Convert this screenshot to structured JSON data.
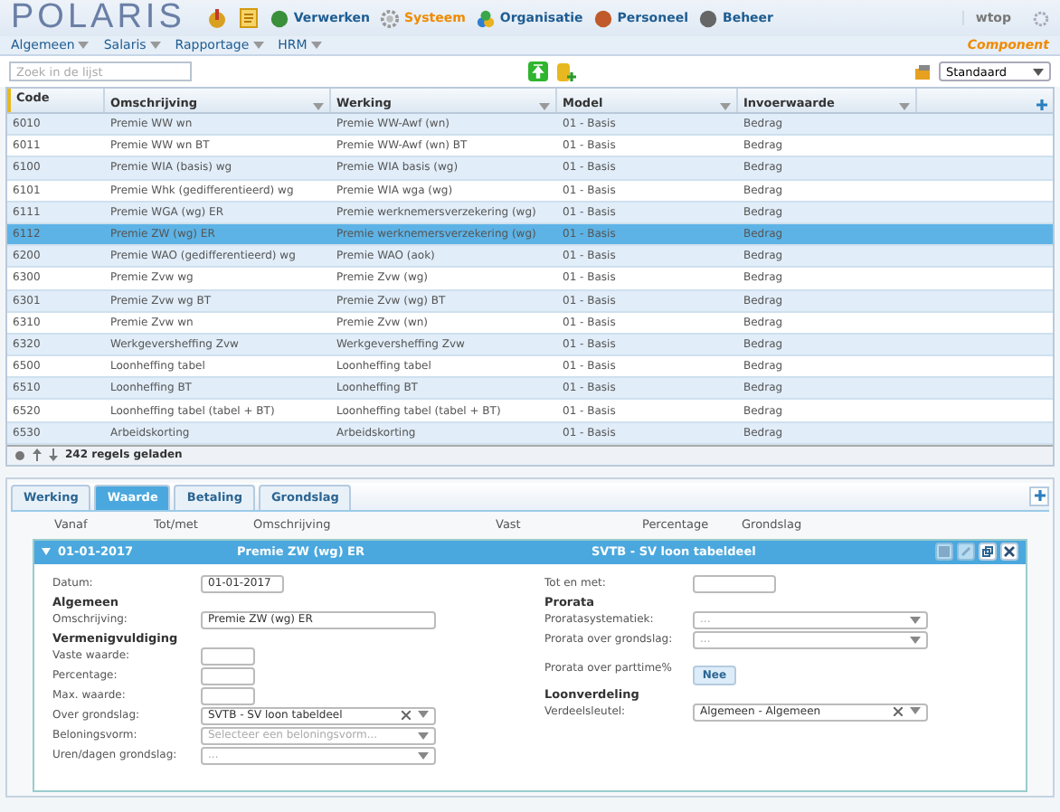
{
  "header": {
    "logo": "POLARIS",
    "modules": [
      {
        "label": "Verwerken",
        "selected": false
      },
      {
        "label": "Systeem",
        "selected": true
      },
      {
        "label": "Organisatie",
        "selected": false
      },
      {
        "label": "Personeel",
        "selected": false
      },
      {
        "label": "Beheer",
        "selected": false
      }
    ],
    "user": "wtop"
  },
  "menu": {
    "items": [
      "Algemeen",
      "Salaris",
      "Rapportage",
      "HRM"
    ],
    "component": "Component"
  },
  "search": {
    "placeholder": "Zoek in de lijst"
  },
  "view_select": {
    "value": "Standaard"
  },
  "table": {
    "columns": [
      "Code",
      "Omschrijving",
      "Werking",
      "Model",
      "Invoerwaarde"
    ],
    "rows": [
      {
        "cells": [
          "6010",
          "Premie WW wn",
          "Premie WW-Awf (wn)",
          "01 - Basis",
          "Bedrag"
        ],
        "selected": false
      },
      {
        "cells": [
          "6011",
          "Premie WW wn BT",
          "Premie WW-Awf (wn) BT",
          "01 - Basis",
          "Bedrag"
        ],
        "selected": false
      },
      {
        "cells": [
          "6100",
          "Premie WIA (basis) wg",
          "Premie WIA basis (wg)",
          "01 - Basis",
          "Bedrag"
        ],
        "selected": false
      },
      {
        "cells": [
          "6101",
          "Premie Whk (gedifferentieerd) wg",
          "Premie WIA wga (wg)",
          "01 - Basis",
          "Bedrag"
        ],
        "selected": false
      },
      {
        "cells": [
          "6111",
          "Premie WGA (wg) ER",
          "Premie werknemersverzekering (wg)",
          "01 - Basis",
          "Bedrag"
        ],
        "selected": false
      },
      {
        "cells": [
          "6112",
          "Premie ZW (wg) ER",
          "Premie werknemersverzekering (wg)",
          "01 - Basis",
          "Bedrag"
        ],
        "selected": true
      },
      {
        "cells": [
          "6200",
          "Premie WAO (gedifferentieerd) wg",
          "Premie WAO (aok)",
          "01 - Basis",
          "Bedrag"
        ],
        "selected": false
      },
      {
        "cells": [
          "6300",
          "Premie Zvw wg",
          "Premie Zvw (wg)",
          "01 - Basis",
          "Bedrag"
        ],
        "selected": false
      },
      {
        "cells": [
          "6301",
          "Premie Zvw wg BT",
          "Premie Zvw (wg) BT",
          "01 - Basis",
          "Bedrag"
        ],
        "selected": false
      },
      {
        "cells": [
          "6310",
          "Premie Zvw wn",
          "Premie Zvw (wn)",
          "01 - Basis",
          "Bedrag"
        ],
        "selected": false
      },
      {
        "cells": [
          "6320",
          "Werkgeversheffing Zvw",
          "Werkgeversheffing Zvw",
          "01 - Basis",
          "Bedrag"
        ],
        "selected": false
      },
      {
        "cells": [
          "6500",
          "Loonheffing tabel",
          "Loonheffing tabel",
          "01 - Basis",
          "Bedrag"
        ],
        "selected": false
      },
      {
        "cells": [
          "6510",
          "Loonheffing BT",
          "Loonheffing BT",
          "01 - Basis",
          "Bedrag"
        ],
        "selected": false
      },
      {
        "cells": [
          "6520",
          "Loonheffing tabel (tabel + BT)",
          "Loonheffing tabel (tabel + BT)",
          "01 - Basis",
          "Bedrag"
        ],
        "selected": false
      },
      {
        "cells": [
          "6530",
          "Arbeidskorting",
          "Arbeidskorting",
          "01 - Basis",
          "Bedrag"
        ],
        "selected": false
      }
    ],
    "status": "242 regels geladen"
  },
  "tabs": [
    {
      "label": "Werking",
      "selected": false
    },
    {
      "label": "Waarde",
      "selected": true
    },
    {
      "label": "Betaling",
      "selected": false
    },
    {
      "label": "Grondslag",
      "selected": false
    }
  ],
  "detail_columns": [
    "Vanaf",
    "Tot/met",
    "Omschrijving",
    "Vast",
    "Percentage",
    "Grondslag"
  ],
  "record": {
    "date": "01-01-2017",
    "description": "Premie ZW (wg) ER",
    "grondslag": "SVTB - SV loon tabeldeel",
    "expanded": true
  },
  "form_left": [
    {
      "kind": "date",
      "label": "Datum:",
      "value": "01-01-2017"
    },
    {
      "kind": "heading",
      "label": "Algemeen"
    },
    {
      "kind": "text",
      "label": "Omschrijving:",
      "value": "Premie ZW (wg) ER"
    },
    {
      "kind": "heading",
      "label": "Vermenigvuldiging"
    },
    {
      "kind": "number",
      "label": "Vaste waarde:"
    },
    {
      "kind": "number",
      "label": "Percentage:"
    },
    {
      "kind": "number",
      "label": "Max. waarde:"
    },
    {
      "kind": "select",
      "label": "Over grondslag:",
      "value": "SVTB - SV loon tabeldeel"
    },
    {
      "kind": "select",
      "label": "Beloningsvorm:",
      "placeholder": "Selecteer een beloningsvorm..."
    },
    {
      "kind": "select",
      "label": "Uren/dagen grondslag:",
      "placeholder": "..."
    }
  ],
  "form_right": [
    {
      "kind": "date",
      "label": "Tot en met:"
    },
    {
      "kind": "heading",
      "label": "Prorata"
    },
    {
      "kind": "select",
      "label": "Proratasystematiek:",
      "placeholder": "..."
    },
    {
      "kind": "select",
      "label": "Prorata over grondslag:",
      "placeholder": "..."
    },
    {
      "kind": "toggle",
      "label": "Prorata over parttime%",
      "value": "Nee"
    },
    {
      "kind": "heading",
      "label": "Loonverdeling"
    },
    {
      "kind": "select",
      "label": "Verdeelsleutel:",
      "value": "Algemeen - Algemeen"
    }
  ]
}
